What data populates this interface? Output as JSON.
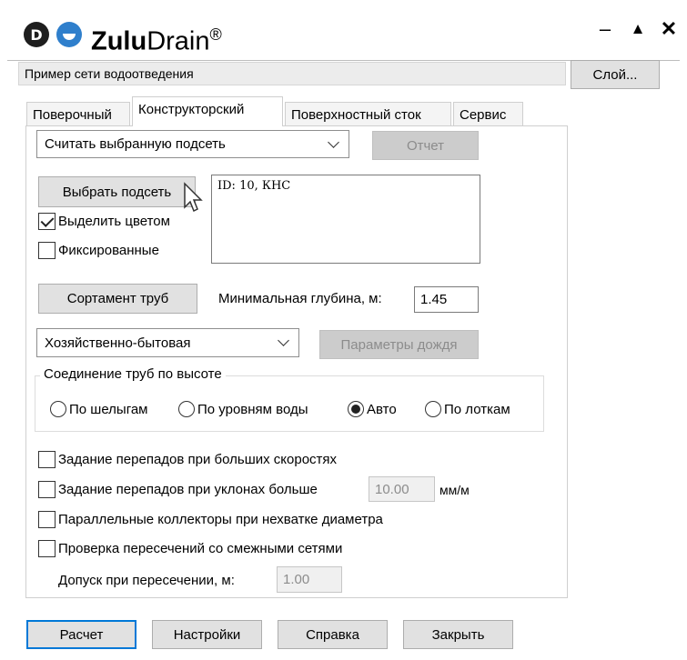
{
  "app": {
    "brand_bold": "Zulu",
    "brand_light": "Drain",
    "brand_reg": "®",
    "logo_letter": "D",
    "window_controls": {
      "minimize": "–",
      "maximize": "▲",
      "close": "✕"
    }
  },
  "network": {
    "name": "Пример сети водоотведения",
    "layer_button": "Слой..."
  },
  "tabs": [
    {
      "label": "Поверочный",
      "active": false
    },
    {
      "label": "Конструкторский",
      "active": true
    },
    {
      "label": "Поверхностный сток",
      "active": false
    },
    {
      "label": "Сервис",
      "active": false
    }
  ],
  "design": {
    "mode_select": {
      "value": "Считать выбранную подсеть"
    },
    "report_button": "Отчет",
    "select_subnet_button": "Выбрать подсеть",
    "highlight_checkbox": {
      "label": "Выделить цветом",
      "checked": true
    },
    "fixed_checkbox": {
      "label": "Фиксированные",
      "checked": false
    },
    "subnet_list": [
      "ID: 10, КНС"
    ],
    "pipe_range_button": "Сортамент труб",
    "min_depth": {
      "label": "Минимальная глубина, м:",
      "value": "1.45"
    },
    "network_type_select": {
      "value": "Хозяйственно-бытовая"
    },
    "rain_params_button": "Параметры дождя",
    "pipe_connection": {
      "legend": "Соединение труб по высоте",
      "options": [
        {
          "label": "По шелыгам",
          "selected": false
        },
        {
          "label": "По уровням воды",
          "selected": false
        },
        {
          "label": "Авто",
          "selected": true
        },
        {
          "label": "По лоткам",
          "selected": false
        }
      ]
    },
    "drops_high_speed": {
      "label": "Задание перепадов при больших скоростях",
      "checked": false
    },
    "drops_slope": {
      "label": "Задание перепадов при уклонах больше",
      "checked": false,
      "value": "10.00",
      "unit": "мм/м"
    },
    "parallel_collectors": {
      "label": "Параллельные коллекторы при нехватке диаметра",
      "checked": false
    },
    "intersection_check": {
      "label": "Проверка пересечений со смежными сетями",
      "checked": false
    },
    "intersection_tolerance": {
      "label": "Допуск при пересечении, м:",
      "value": "1.00"
    }
  },
  "footer": {
    "calc_button": "Расчет",
    "settings_button": "Настройки",
    "help_button": "Справка",
    "close_button": "Закрыть"
  },
  "colors": {
    "accent_border": "#0078d7",
    "logo_dark": "#1e1e1e",
    "logo_blue": "#2f7fcc"
  }
}
